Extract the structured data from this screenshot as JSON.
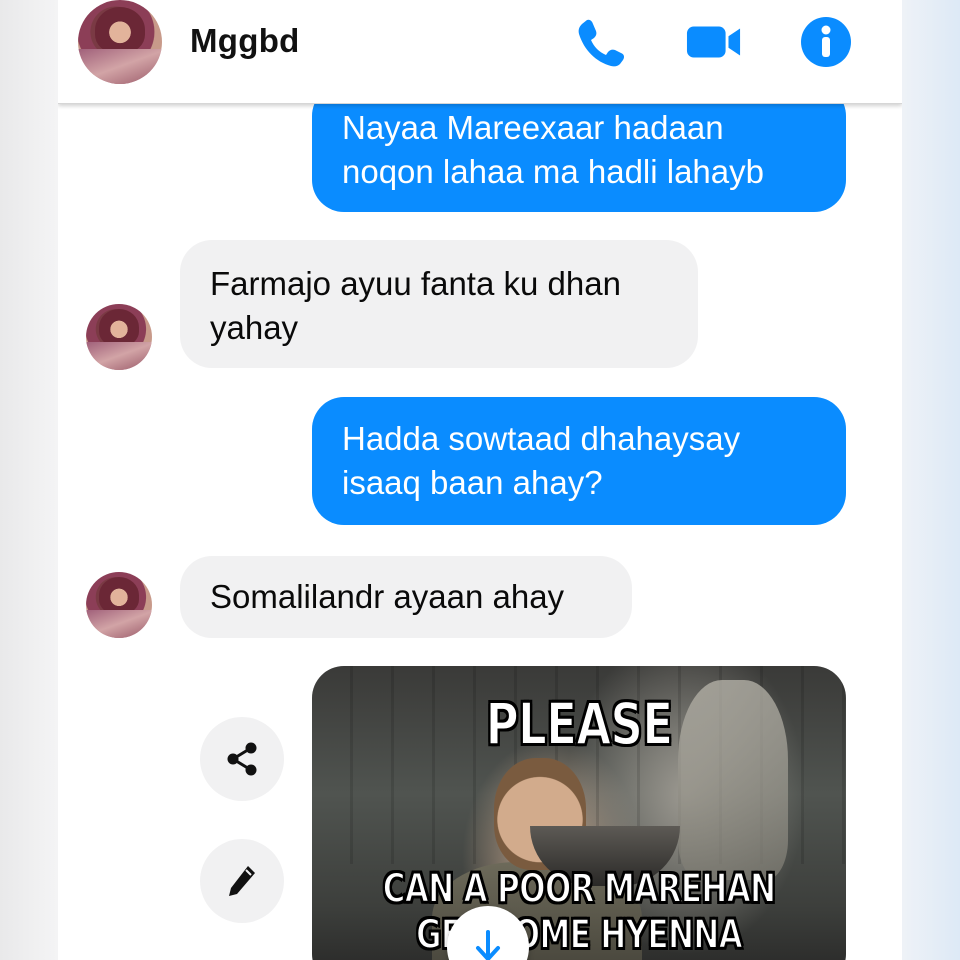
{
  "header": {
    "contact_name": "Mggbd",
    "icons": [
      "phone-icon",
      "video-camera-icon",
      "info-icon"
    ]
  },
  "messages": [
    {
      "direction": "outgoing",
      "text": "Nayaa Mareexaar hadaan noqon lahaa ma hadli lahayb"
    },
    {
      "direction": "incoming",
      "text": "Farmajo ayuu fanta ku dhan yahay"
    },
    {
      "direction": "outgoing",
      "text": "Hadda sowtaad dhahaysay isaaq baan ahay?"
    },
    {
      "direction": "incoming",
      "text": "Somalilandr ayaan ahay"
    }
  ],
  "meme": {
    "top_text": "PLEASE",
    "bottom_text": "CAN A POOR MAREHAN GET SOME HYENNA MEAT?"
  },
  "actions": [
    "share-icon",
    "pencil-icon",
    "download-icon"
  ],
  "colors": {
    "accent": "#0a8cff",
    "incoming_bubble": "#f1f1f2",
    "header_bg": "#ffffff"
  }
}
